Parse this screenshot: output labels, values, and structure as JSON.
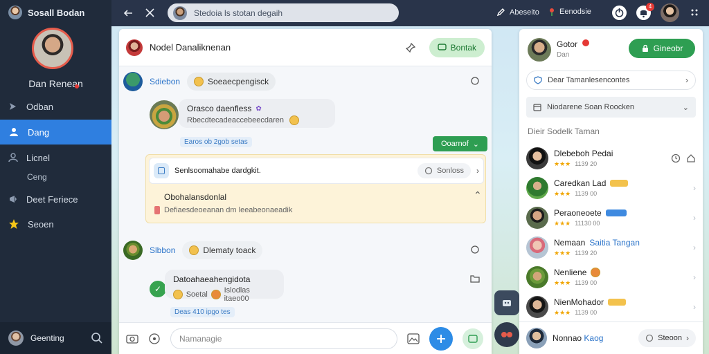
{
  "sidebar": {
    "brand": "Sosall Bodan",
    "profile_name": "Dan Renean",
    "nav": [
      {
        "label": "Odban",
        "icon": "arrow-icon"
      },
      {
        "label": "Dang",
        "icon": "people-icon",
        "active": true
      },
      {
        "label": "Licnel",
        "icon": "user-icon"
      },
      {
        "label": "Ceng",
        "icon": "",
        "sub": true
      },
      {
        "label": "Deet Feriece",
        "icon": "megaphone-icon"
      },
      {
        "label": "Seoen",
        "icon": "star-icon"
      }
    ],
    "footer_label": "Geenting"
  },
  "topbar": {
    "search_text": "Stedoia ls stotan degaih",
    "item1": "Abeseito",
    "item2": "Eenodsie",
    "badge": "4"
  },
  "chat": {
    "title": "Nodel Danaliknenan",
    "header_button": "Bontak",
    "post1": {
      "author": "Sdiebon",
      "chip": "Soeaecpengisck",
      "reply_author": "Orasco daenfless",
      "reply_text": "Rbecdtecadeaccebeecdaren",
      "time": "Earos ob 2gob  setas"
    },
    "action_button": "Ooarnof",
    "composer": {
      "text": "Senlsoomahabe dardgkit.",
      "chip": "Sonloss"
    },
    "notice": {
      "title": "Obohalansdonlal",
      "text": "Defiaesdeoeanan dm leeabeonaeadik"
    },
    "post2": {
      "author": "Slbbon",
      "chip": "Dlematy toack",
      "reply_author": "Datoahaeahengidota",
      "reply_r1": "Soetal",
      "reply_r2": "Islodlas itaeo00",
      "time": "Deas 410  ipgo  tes"
    },
    "input_placeholder": "Namanagie"
  },
  "right": {
    "user_name": "Gotor",
    "user_sub": "Dan",
    "button": "Gineobr",
    "dropdown1": "Dear Tamanlesencontes",
    "dropdown2": "Niodarene Soan Roocken",
    "section_title": "Dieir Sodelk Taman",
    "friends": [
      {
        "name": "Dlebeboh Pedai",
        "meta": "1139 20",
        "tag": ""
      },
      {
        "name": "Caredkan Lad",
        "meta": "1139 00",
        "tag": "",
        "tag_color": "#f3c24d"
      },
      {
        "name": "Peraoneoete",
        "meta": "11130 00",
        "tag": "",
        "tag_color": "#3f8ae0"
      },
      {
        "name": "Nemaan",
        "name2": "Saitia Tangan",
        "meta": "1139 20",
        "tag": ""
      },
      {
        "name": "Nenliene",
        "meta": "1139 00",
        "tag": ""
      },
      {
        "name": "NienMohador",
        "meta": "1139 00",
        "tag": "",
        "tag_color": "#f3c24d"
      },
      {
        "name": "Nonnao",
        "name2": "Kaog",
        "meta": "",
        "tag": ""
      }
    ],
    "footer_button": "Steoon"
  }
}
